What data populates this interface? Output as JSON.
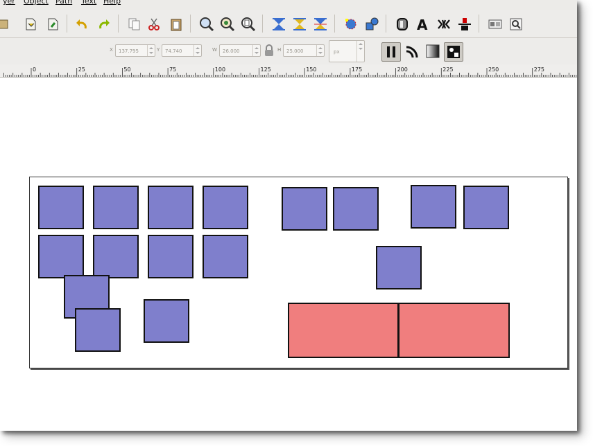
{
  "menu": {
    "items": [
      "yer",
      "Object",
      "Path",
      "Text",
      "Help"
    ]
  },
  "toolbar": {
    "x_label": "X",
    "x_value": "137.795",
    "y_label": "Y",
    "y_value": "74.740",
    "w_label": "W",
    "w_value": "26.000",
    "h_label": "H",
    "h_value": "25.000",
    "unit": "px"
  },
  "ruler": {
    "labels": [
      "0",
      "25",
      "50",
      "75",
      "100",
      "125",
      "150",
      "175",
      "200",
      "225",
      "250",
      "275"
    ]
  },
  "colors": {
    "square_fill": "#7f7fcc",
    "rect_fill": "#f07e7e",
    "stroke": "#111111"
  },
  "icons": {
    "command_bar": [
      "open-icon",
      "import-icon",
      "export-icon",
      "undo-icon",
      "redo-icon",
      "copy-icon",
      "cut-icon",
      "paste-icon",
      "zoom-selection-icon",
      "zoom-drawing-icon",
      "zoom-page-icon",
      "align-top-icon",
      "align-middle-icon",
      "align-bottom-icon",
      "node-edit-icon",
      "transform-icon",
      "fill-stroke-icon",
      "text-icon",
      "xml-editor-icon",
      "align-distribute-icon",
      "preferences-icon",
      "document-properties-icon"
    ],
    "control_bar": [
      "raise-to-top-icon",
      "rotate-icon",
      "lower-icon",
      "flip-icon",
      "lock-icon",
      "scale-stroke-icon",
      "scale-radius-icon",
      "move-gradient-icon",
      "move-pattern-icon"
    ]
  }
}
